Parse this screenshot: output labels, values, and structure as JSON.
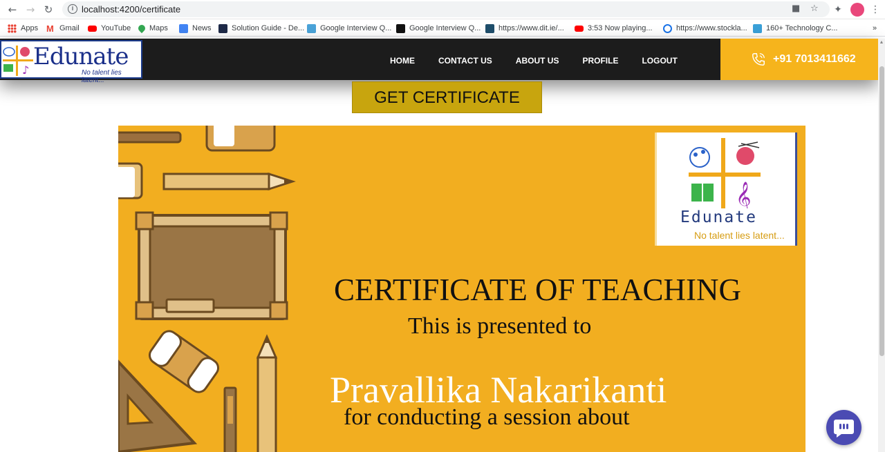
{
  "browser": {
    "url": "localhost:4200/certificate",
    "bookmarks": [
      {
        "label": "Apps",
        "color": "#e94235"
      },
      {
        "label": "Gmail",
        "color": "#ea4335"
      },
      {
        "label": "YouTube",
        "color": "#ff0000"
      },
      {
        "label": "Maps",
        "color": "#34a853"
      },
      {
        "label": "News",
        "color": "#4285f4"
      },
      {
        "label": "Solution Guide - De...",
        "color": "#1e2a48"
      },
      {
        "label": "Google Interview Q...",
        "color": "#4aa3d8"
      },
      {
        "label": "Google Interview Q...",
        "color": "#111111"
      },
      {
        "label": "https://www.dit.ie/...",
        "color": "#1f4e6b"
      },
      {
        "label": "3:53 Now playing...",
        "color": "#ff0000"
      },
      {
        "label": "https://www.stockla...",
        "color": "#1a73e8"
      },
      {
        "label": "160+ Technology C...",
        "color": "#3aa0d8"
      }
    ],
    "overflow_label": "»"
  },
  "site": {
    "logo_word": "Edunate",
    "logo_tag": "No talent lies latent...",
    "nav": [
      "HOME",
      "CONTACT US",
      "ABOUT US",
      "PROFILE",
      "LOGOUT"
    ],
    "phone": "+91 7013411662",
    "accent": "#f6b41c",
    "dark": "#1c1c1c"
  },
  "main": {
    "get_certificate_label": "GET CERTIFICATE"
  },
  "certificate": {
    "logo_word": "Edunate",
    "logo_tag": "No talent lies latent...",
    "title": "CERTIFICATE OF TEACHING",
    "presented": "This is presented to",
    "name": "Pravallika Nakarikanti",
    "reason": "for conducting a session about",
    "background": "#f2ae20"
  }
}
